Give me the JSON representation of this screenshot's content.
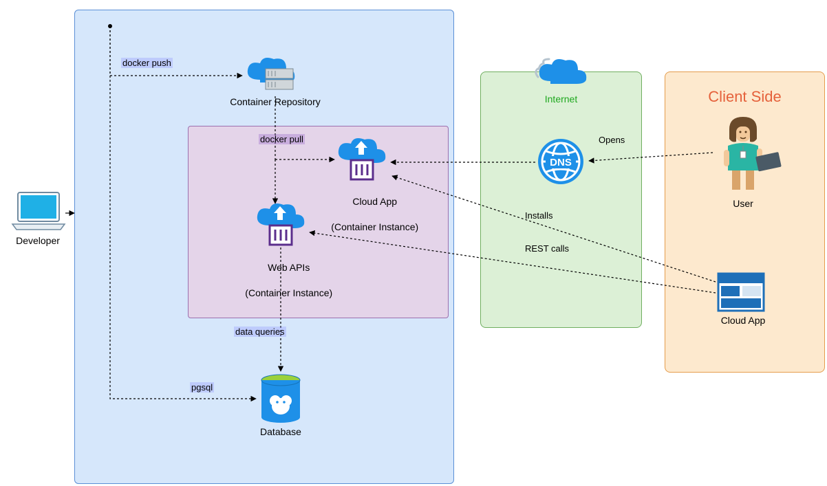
{
  "nodes": {
    "developer": "Developer",
    "container_repo": "Container Repository",
    "cloud_app_ci_line1": "Cloud App",
    "cloud_app_ci_line2": "(Container Instance)",
    "web_apis_line1": "Web APIs",
    "web_apis_line2": "(Container Instance)",
    "database": "Database",
    "internet": "Internet",
    "dns": "DNS",
    "user": "User",
    "client_cloud_app": "Cloud App",
    "client_side_title": "Client Side"
  },
  "edges": {
    "docker_push": "docker push",
    "docker_pull": "docker pull",
    "data_queries": "data queries",
    "pgsql": "pgsql",
    "opens": "Opens",
    "installs": "Installs",
    "rest_calls": "REST calls"
  },
  "colors": {
    "cloud_box_fill": "#D6E7FB",
    "cloud_box_stroke": "#5A8FD6",
    "inner_box_fill": "#E4D4E9",
    "inner_box_stroke": "#9B6FAE",
    "internet_box_fill": "#DCF0D6",
    "internet_box_stroke": "#6FAE5F",
    "client_box_fill": "#FDE9CE",
    "client_box_stroke": "#E59C4B",
    "internet_text": "#1EA81E",
    "client_title": "#E5613B",
    "azure_blue": "#1E90E8",
    "purple": "#5B2E8C",
    "teal": "#2AB5A4"
  }
}
